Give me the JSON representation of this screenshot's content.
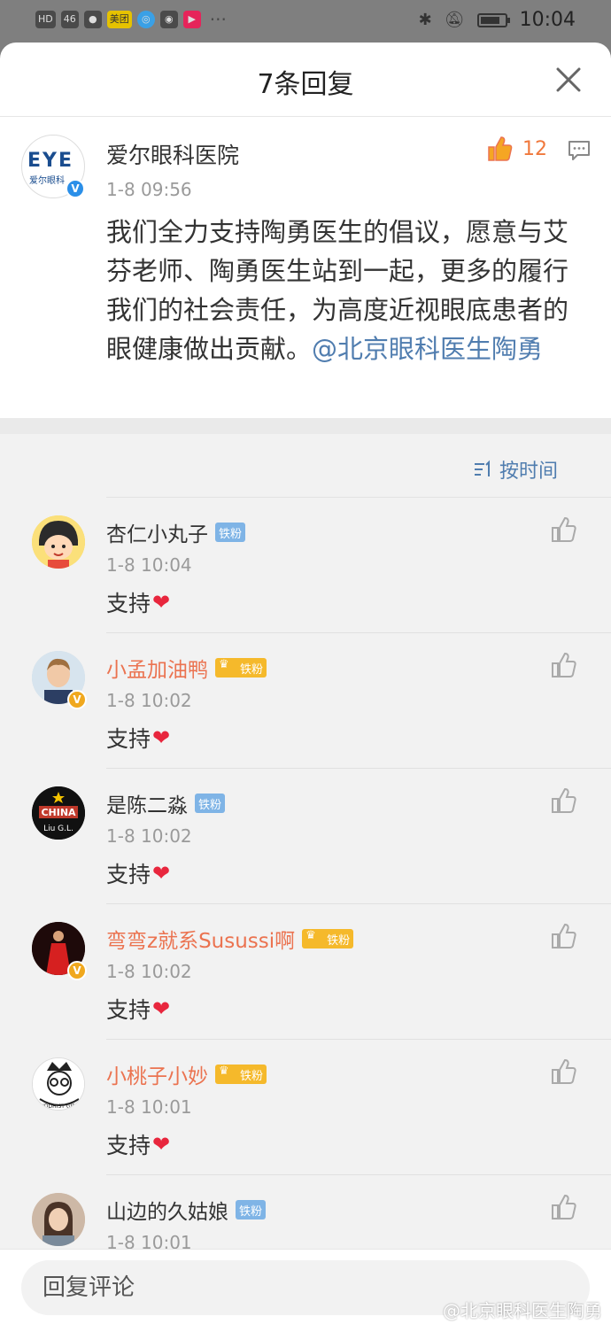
{
  "statusbar": {
    "hd": "HD",
    "signal": "46",
    "meituan": "美团",
    "time": "10:04"
  },
  "sheet": {
    "title": "7条回复",
    "close_icon": "close-icon"
  },
  "main_comment": {
    "avatar_logo": "EYE",
    "avatar_sub": "爱尔眼科",
    "author": "爱尔眼科医院",
    "time": "1-8 09:56",
    "likes": "12",
    "text_plain": "我们全力支持陶勇医生的倡议，愿意与艾芬老师、陶勇医生站到一起，更多的履行我们的社会责任，为高度近视眼底患者的眼健康做出贡献。",
    "mention": "@北京眼科医生陶勇"
  },
  "sort": {
    "label": "按时间"
  },
  "replies": [
    {
      "name": "杏仁小丸子",
      "badge": "铁粉",
      "vip": false,
      "verified": false,
      "time": "1-8 10:04",
      "text": "支持"
    },
    {
      "name": "小孟加油鸭",
      "badge": "铁粉",
      "vip": true,
      "verified": true,
      "time": "1-8 10:02",
      "text": "支持"
    },
    {
      "name": "是陈二淼",
      "badge": "铁粉",
      "vip": false,
      "verified": false,
      "time": "1-8 10:02",
      "text": "支持",
      "avatar_text_1": "CHINA",
      "avatar_text_2": "Liu G.L."
    },
    {
      "name": "弯弯z就系Susussi啊",
      "badge": "铁粉",
      "vip": true,
      "verified": true,
      "time": "1-8 10:02",
      "text": "支持"
    },
    {
      "name": "小桃子小妙",
      "badge": "铁粉",
      "vip": true,
      "verified": false,
      "time": "1-8 10:01",
      "text": "支持",
      "avatar_text_1": "BUDDHIST GIRLS"
    },
    {
      "name": "山边的久姑娘",
      "badge": "铁粉",
      "vip": false,
      "verified": false,
      "time": "1-8 10:01",
      "text": ""
    }
  ],
  "bottom": {
    "placeholder": "回复评论"
  },
  "watermark": "@北京眼科医生陶勇",
  "colors": {
    "accent_blue": "#507daf",
    "vip_orange": "#eb7350",
    "like_orange": "#f0783c",
    "fan_badge": "#7fb4e6",
    "gold_badge": "#f5b92b"
  }
}
